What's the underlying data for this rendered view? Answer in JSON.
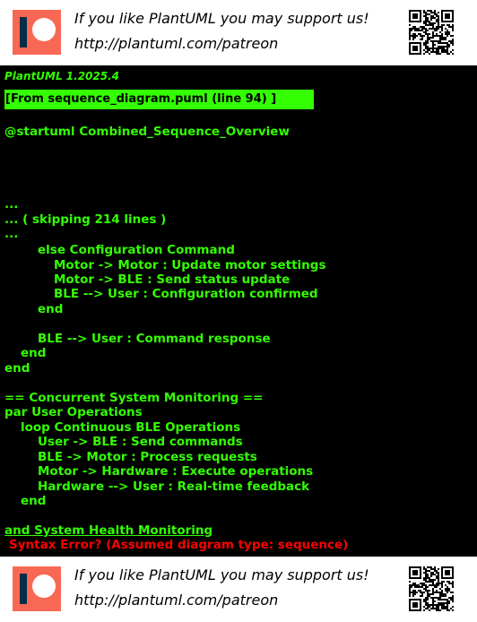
{
  "banner": {
    "line1": "If you like PlantUML you may support us!",
    "line2": "http://plantuml.com/patreon"
  },
  "console": {
    "version": "PlantUML 1.2025.4",
    "from_label": "[From sequence_diagram.puml (line 94) ]",
    "lines": [
      "@startuml Combined_Sequence_Overview",
      "...",
      "... ( skipping 214 lines )",
      "...",
      "else Configuration Command",
      "Motor -> Motor : Update motor settings",
      "Motor -> BLE : Send status update",
      "BLE --> User : Configuration confirmed",
      "end",
      "BLE --> User : Command response",
      "end",
      "end",
      "== Concurrent System Monitoring ==",
      "par User Operations",
      "loop Continuous BLE Operations",
      "User -> BLE : Send commands",
      "BLE -> Motor : Process requests",
      "Motor -> Hardware : Execute operations",
      "Hardware --> User : Real-time feedback",
      "end",
      "and System Health Monitoring"
    ],
    "error": "Syntax Error? (Assumed diagram type: sequence)"
  },
  "colors": {
    "console_bg": "#000000",
    "console_text": "#33ff02",
    "error_text": "#ff0000",
    "patreon_logo": "#f96854",
    "patreon_bar": "#052d49"
  },
  "icons": [
    "patreon-logo-icon",
    "qr-code-icon"
  ]
}
